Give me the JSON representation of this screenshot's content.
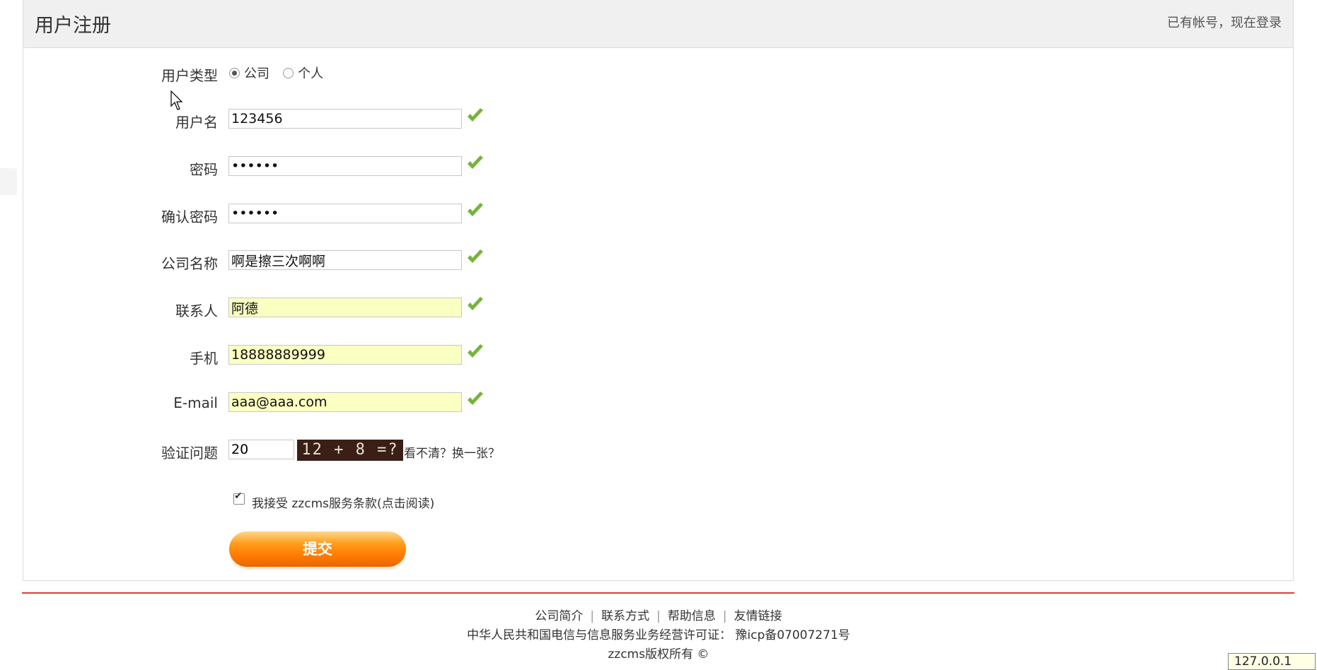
{
  "header": {
    "title": "用户注册",
    "login_link": "已有帐号，现在登录"
  },
  "form": {
    "user_type": {
      "label": "用户类型",
      "options": [
        "公司",
        "个人"
      ],
      "selected": "公司"
    },
    "username": {
      "label": "用户名",
      "value": "123456"
    },
    "password": {
      "label": "密码",
      "value": "••••••"
    },
    "confirm_password": {
      "label": "确认密码",
      "value": "••••••"
    },
    "company": {
      "label": "公司名称",
      "value": "啊是擦三次啊啊"
    },
    "contact": {
      "label": "联系人",
      "value": "阿德"
    },
    "mobile": {
      "label": "手机",
      "value": "18888889999"
    },
    "email": {
      "label": "E-mail",
      "value": "aaa@aaa.com"
    },
    "captcha": {
      "label": "验证问题",
      "value": "20",
      "image_text": "12 + 8  =?",
      "refresh_link": "看不清？换一张？"
    },
    "agree": {
      "text": "我接受 zzcms服务条款(点击阅读)",
      "checked": true
    },
    "submit_label": "提交"
  },
  "footer": {
    "links": [
      "公司简介",
      "联系方式",
      "帮助信息",
      "友情链接"
    ],
    "license": "中华人民共和国电信与信息服务业务经营许可证： 豫icp备07007271号",
    "copyright": "zzcms版权所有 ©"
  },
  "status": {
    "ip": "127.0.0.1"
  },
  "colors": {
    "accent_orange": "#ff7a00",
    "divider_red": "#e23a3a",
    "valid_green": "#77b33b",
    "autofill_yellow": "#faffc2"
  }
}
